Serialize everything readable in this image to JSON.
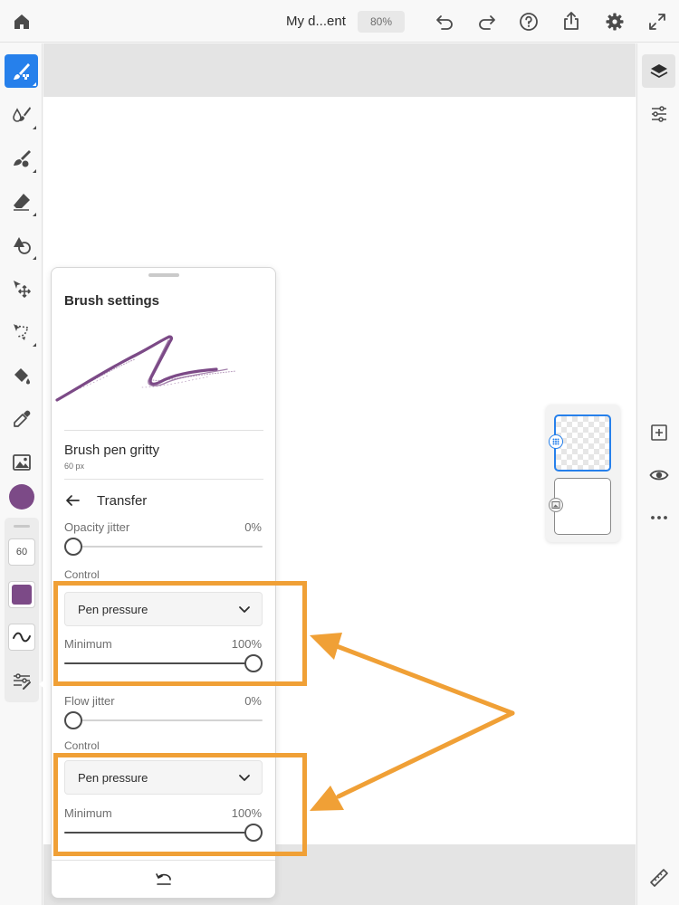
{
  "topbar": {
    "doc_title": "My d...ent",
    "zoom": "80%",
    "icons": [
      "home-icon",
      "undo-icon",
      "redo-icon",
      "help-icon",
      "share-icon",
      "settings-icon",
      "fullscreen-icon"
    ]
  },
  "left_toolbar": {
    "tools": [
      "paint-brush-icon",
      "watercolor-icon",
      "oil-brush-icon",
      "eraser-icon",
      "shape-icon",
      "transform-icon",
      "lasso-icon",
      "fill-icon",
      "eyedropper-icon",
      "image-icon"
    ],
    "active_tool": "paint-brush-icon",
    "color": "#7c4a87",
    "mini_panel": {
      "size": "60",
      "color": "#7c4a87",
      "icons": [
        "brush-stroke-icon",
        "brush-settings-icon"
      ]
    }
  },
  "right_toolbar": {
    "icons": [
      "layers-icon",
      "adjustments-icon",
      "add-layer-icon",
      "visibility-icon",
      "more-icon",
      "ruler-icon"
    ]
  },
  "layers": [
    "paint-layer",
    "image-layer"
  ],
  "brush_panel": {
    "title": "Brush settings",
    "brush_name": "Brush pen gritty",
    "brush_size": "60 px",
    "section": "Transfer",
    "opacity_jitter": {
      "label": "Opacity jitter",
      "value": "0%",
      "level": 0
    },
    "control_1": {
      "label": "Control",
      "dropdown": "Pen pressure",
      "minimum_label": "Minimum",
      "minimum_value": "100%",
      "level": 1
    },
    "flow_jitter": {
      "label": "Flow jitter",
      "value": "0%",
      "level": 0
    },
    "control_2": {
      "label": "Control",
      "dropdown": "Pen pressure",
      "minimum_label": "Minimum",
      "minimum_value": "100%",
      "level": 1
    },
    "footer_icon": "reset-icon",
    "stroke_color": "#7c4a87"
  },
  "annotation": {
    "color": "#f0a036"
  }
}
